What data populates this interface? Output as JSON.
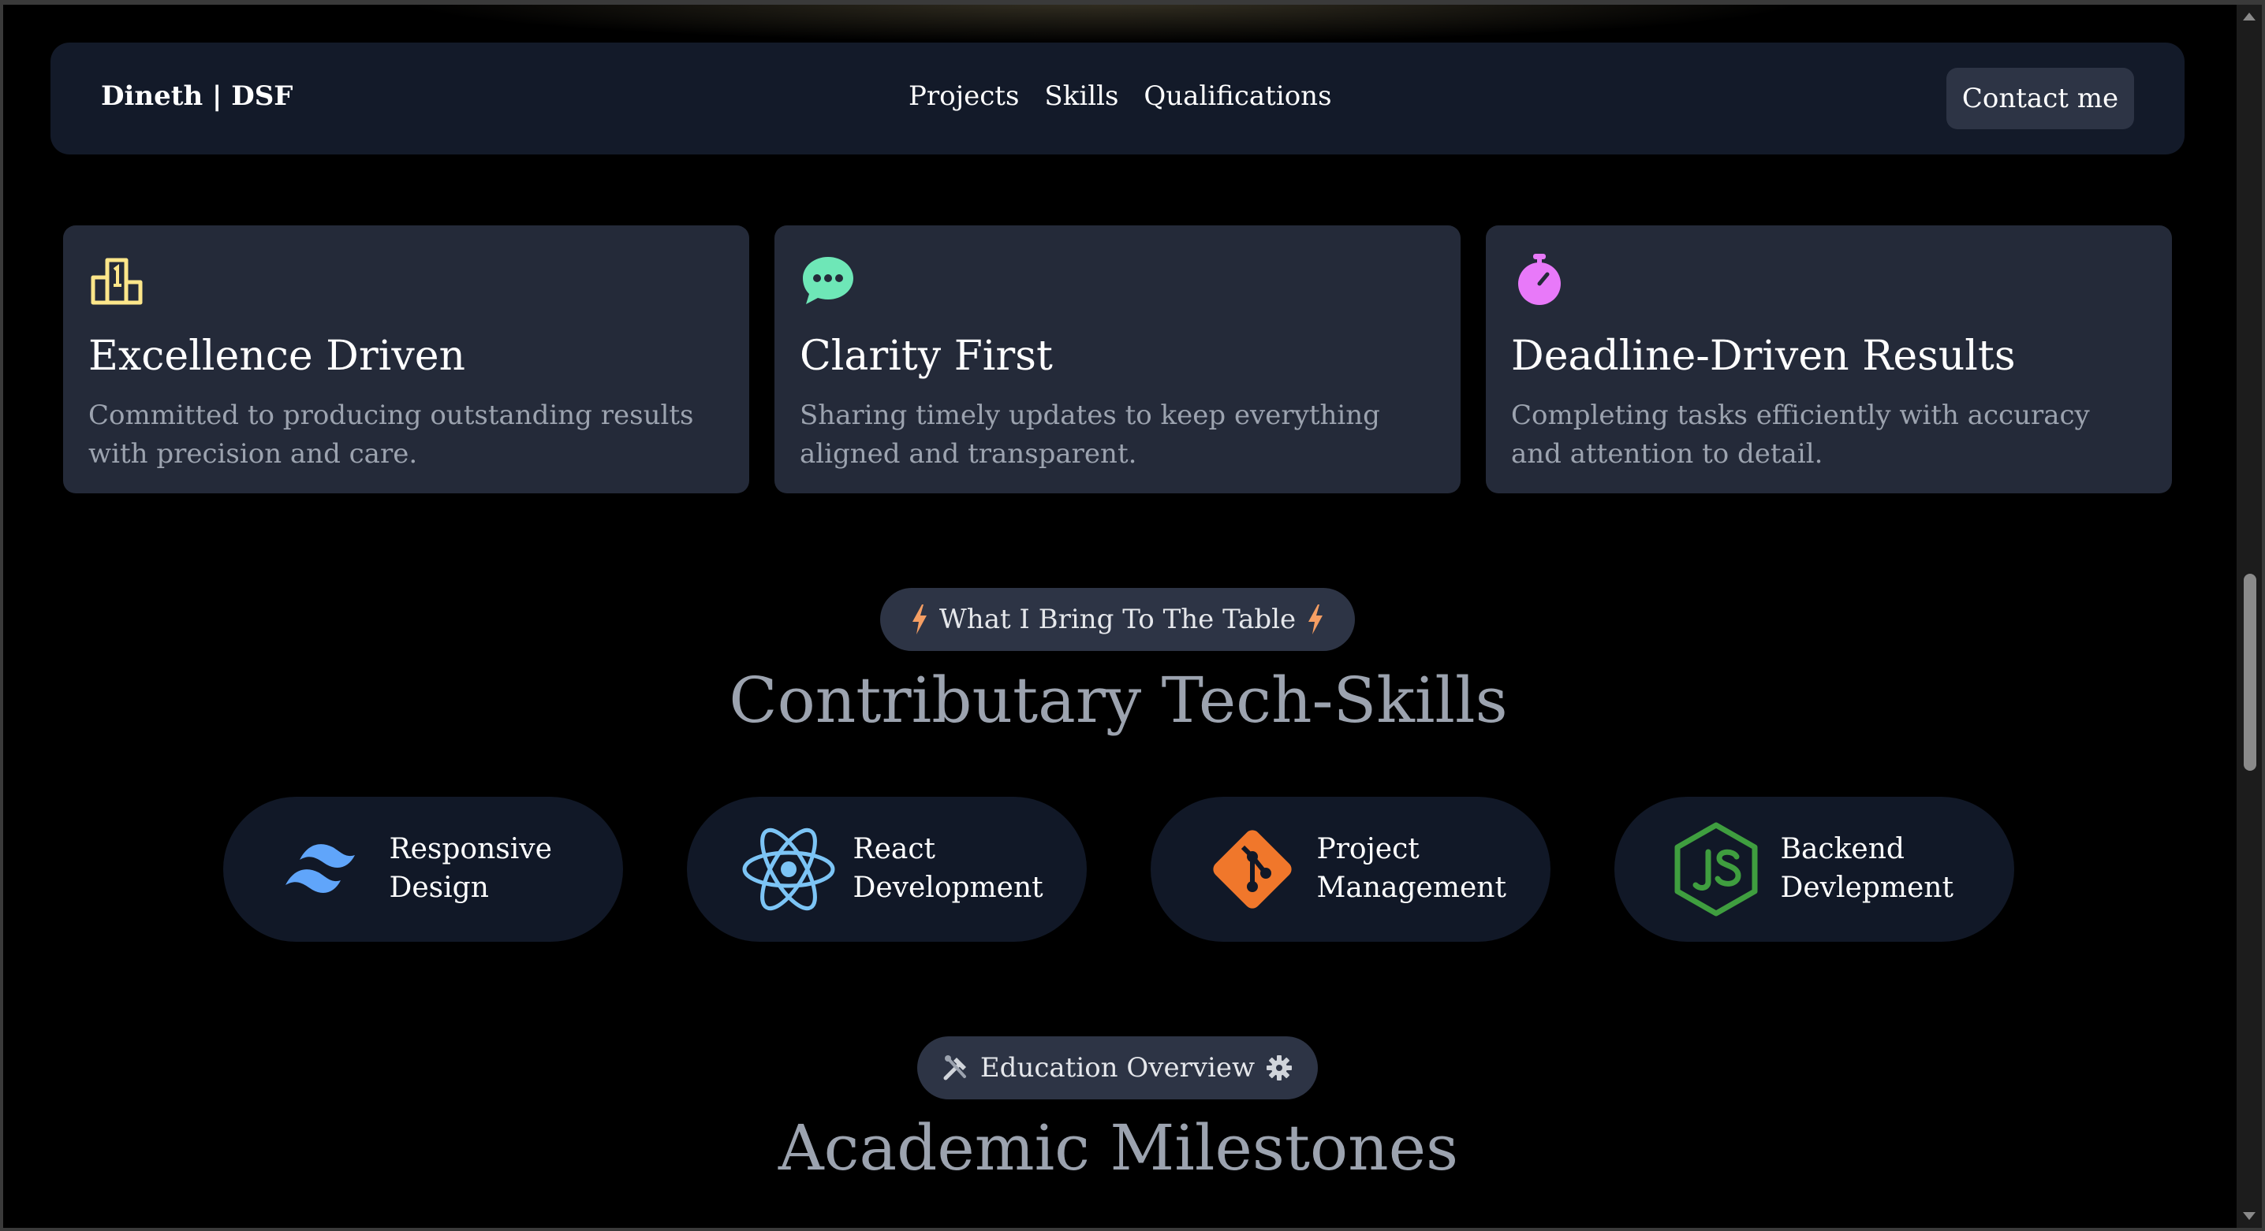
{
  "navbar": {
    "brand": "Dineth | DSF",
    "links": [
      "Projects",
      "Skills",
      "Qualifications"
    ],
    "contact_label": "Contact me"
  },
  "values": [
    {
      "icon": "trophy-podium-icon",
      "color": "#fde68a",
      "title": "Excellence Driven",
      "description": "Committed to producing outstanding results with precision and care."
    },
    {
      "icon": "chat-bubble-icon",
      "color": "#6ee7b7",
      "title": "Clarity First",
      "description": "Sharing timely updates to keep everything aligned and transparent."
    },
    {
      "icon": "stopwatch-icon",
      "color": "#e879f9",
      "title": "Deadline-Driven Results",
      "description": "Completing tasks efficiently with accuracy and attention to detail."
    }
  ],
  "tech_section": {
    "pill_label": "What I Bring To The Table",
    "pill_icon": "lightning-icon",
    "heading": "Contributary Tech-Skills"
  },
  "skills": [
    {
      "icon": "tailwind-icon",
      "label": "Responsive Design",
      "color": "#60a5fa"
    },
    {
      "icon": "react-icon",
      "label": "React Development",
      "color": "#7cc4f5"
    },
    {
      "icon": "git-icon",
      "label": "Project Management",
      "color": "#f0772b"
    },
    {
      "icon": "nodejs-icon",
      "label": "Backend Devlepment",
      "color": "#3f9e3f"
    }
  ],
  "edu_section": {
    "pill_label": "Education Overview",
    "pill_icons": [
      "tools-icon",
      "gear-icon"
    ],
    "heading": "Academic Milestones"
  }
}
